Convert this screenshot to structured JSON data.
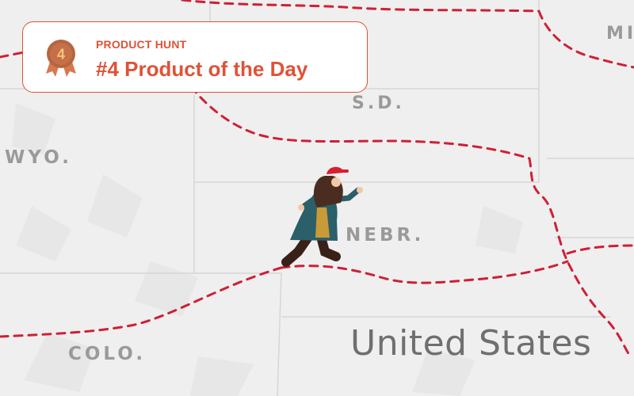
{
  "colors": {
    "background": "#efefef",
    "border_line": "#cf1f36",
    "state_label": "#9a9a9a",
    "country_label": "#6f6f6f",
    "badge_accent": "#df5236",
    "medal": "#b5663f"
  },
  "badge": {
    "eyebrow": "PRODUCT HUNT",
    "title": "#4 Product of the Day",
    "rank": "4",
    "icon": "medal-icon"
  },
  "map": {
    "state_labels": {
      "mi": "MI",
      "sd": "S.D.",
      "wyo": "WYO.",
      "nebr": "NEBR.",
      "colo": "COLO."
    },
    "country_label": "United States",
    "runner_icon": "running-person-icon"
  }
}
